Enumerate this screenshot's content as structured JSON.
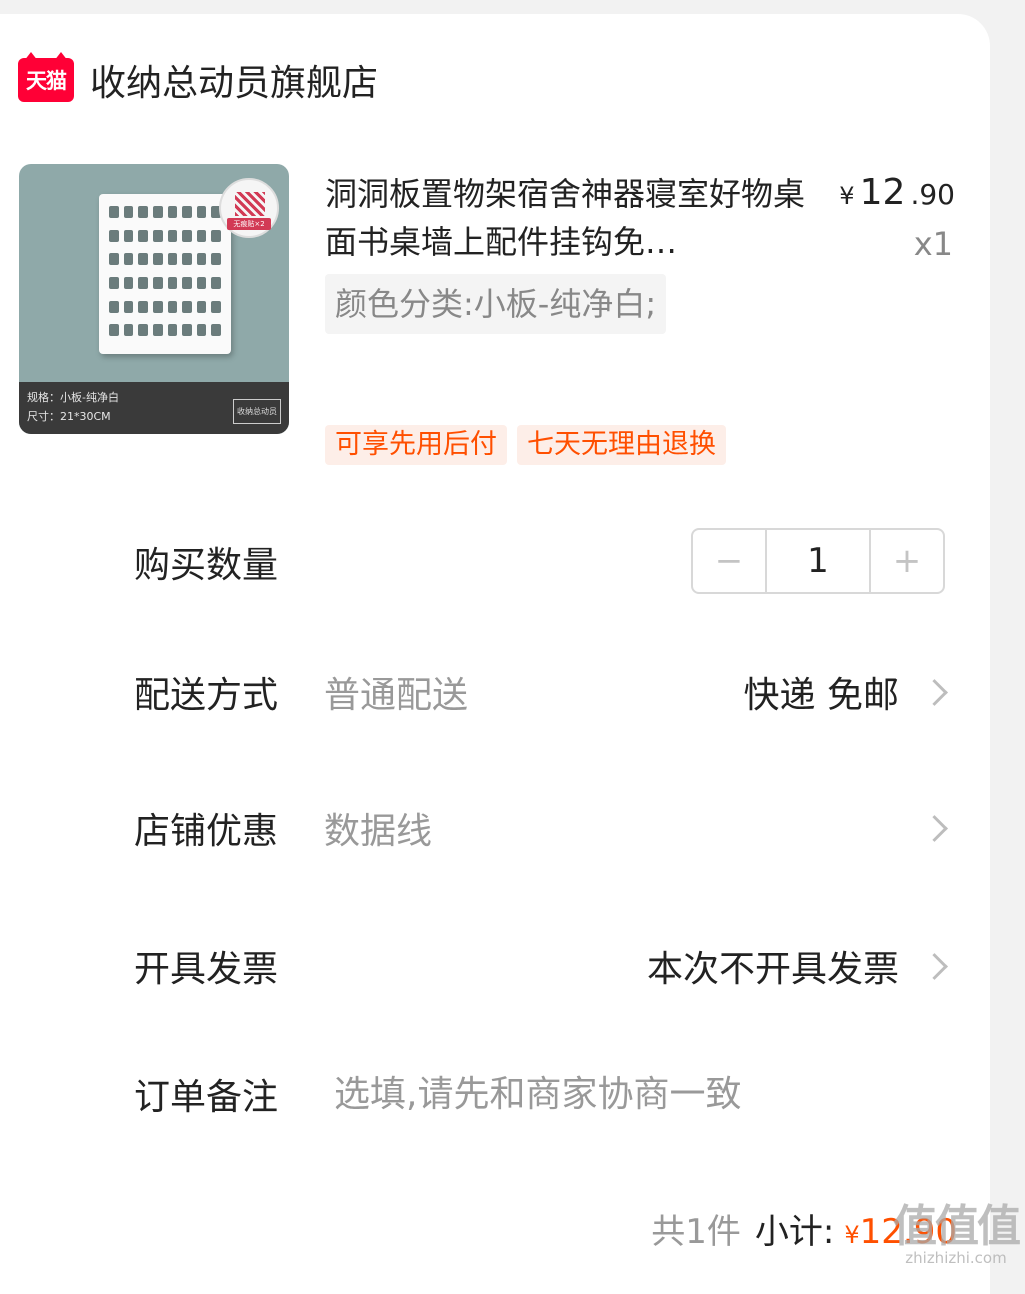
{
  "shop": {
    "badge": "天猫",
    "name": "收纳总动员旗舰店"
  },
  "product": {
    "image_caption": [
      "规格：小板-纯净白",
      "尺寸：21*30CM"
    ],
    "image_badge": "无痕贴×2",
    "image_brand": "收纳总动员",
    "title": "洞洞板置物架宿舍神器寝室好物桌面书桌墙上配件挂钩免…",
    "price": {
      "symbol": "¥",
      "integer": "12",
      "decimal": ".90"
    },
    "quantity_label": "x1",
    "spec": "颜色分类:小板-纯净白;",
    "tags": [
      "可享先用后付",
      "七天无理由退换"
    ]
  },
  "quantity_row": {
    "label": "购买数量",
    "value": "1",
    "minus": "−",
    "plus": "+"
  },
  "delivery_row": {
    "label": "配送方式",
    "sub": "普通配送",
    "value": "快递 免邮"
  },
  "discount_row": {
    "label": "店铺优惠",
    "sub": "数据线"
  },
  "invoice_row": {
    "label": "开具发票",
    "value": "本次不开具发票"
  },
  "memo_row": {
    "label": "订单备注",
    "placeholder": "选填,请先和商家协商一致"
  },
  "summary": {
    "count": "共1件",
    "subtotal_label": "小计:",
    "symbol": "¥",
    "amount": "12.90"
  },
  "watermark": {
    "logo": "值值值",
    "url": "zhizhizhi.com"
  },
  "colors": {
    "accent": "#ff5000",
    "tmall_red": "#ff0036",
    "tag_bg": "#fdeee8"
  }
}
